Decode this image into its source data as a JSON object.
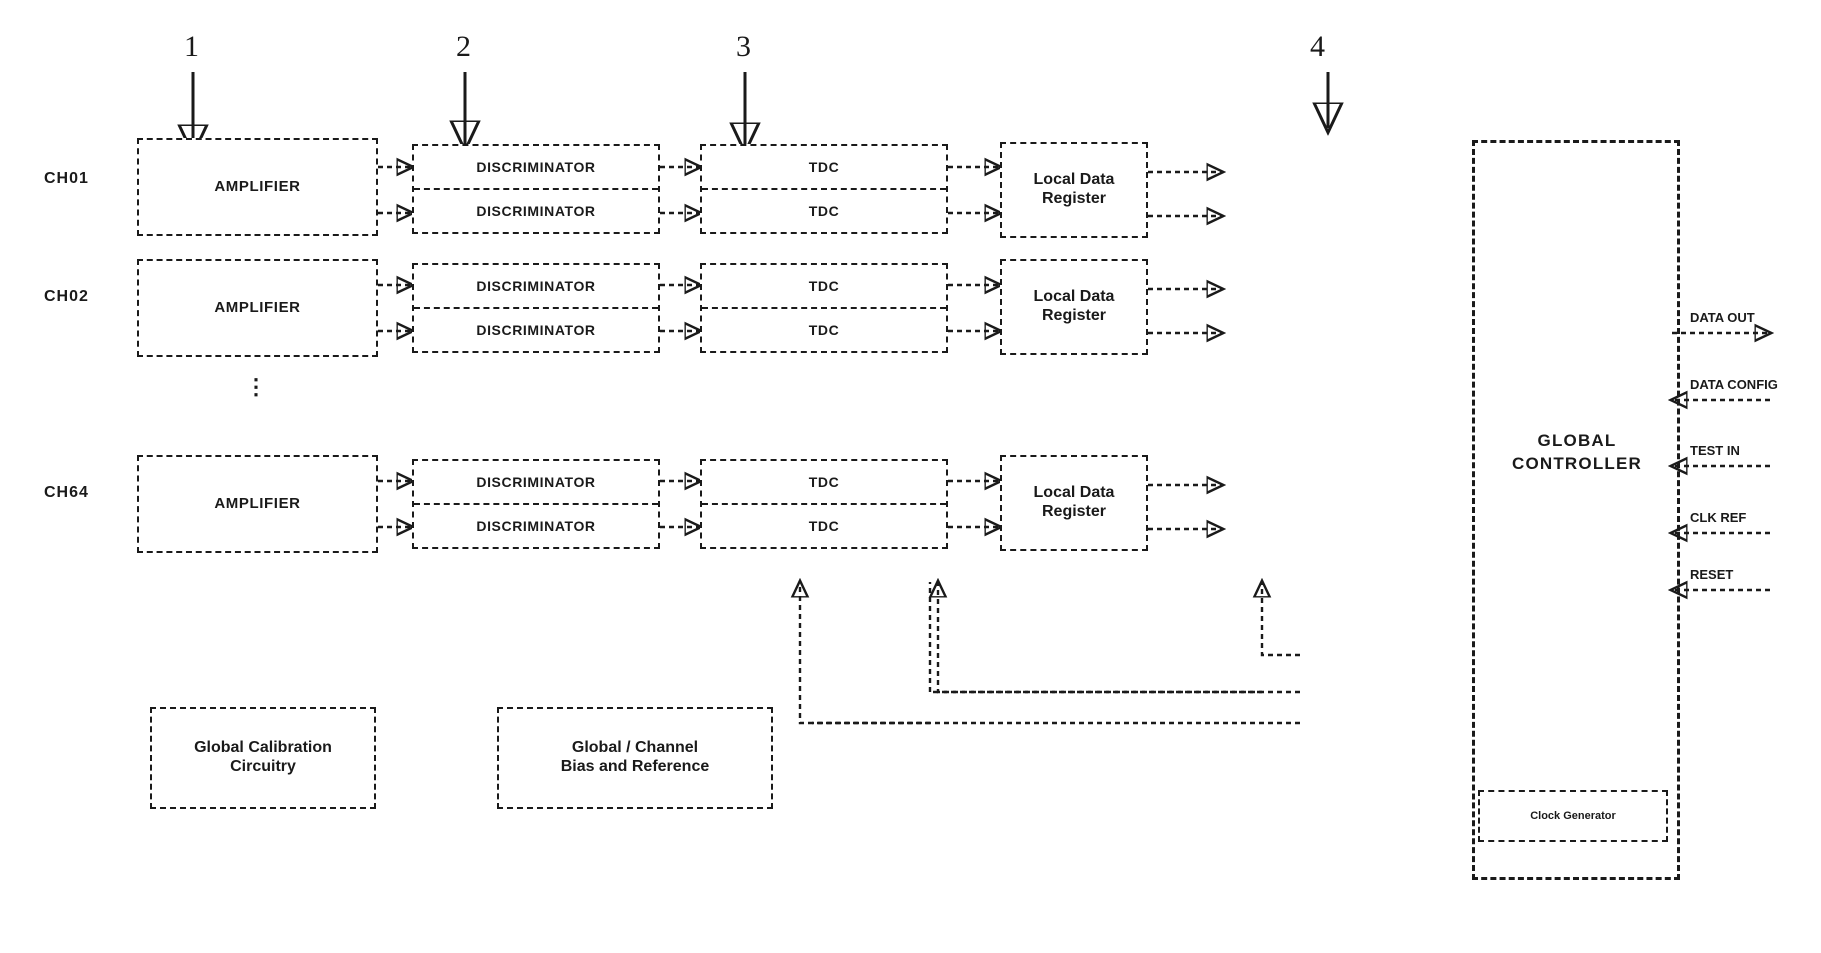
{
  "figure": {
    "title": "Front-end readout ASIC block diagram",
    "ink_color": "#1a1a1a",
    "background": "#ffffff"
  },
  "reference_numerals": [
    {
      "id": "ref-1",
      "text": "1"
    },
    {
      "id": "ref-2",
      "text": "2"
    },
    {
      "id": "ref-3",
      "text": "3"
    },
    {
      "id": "ref-4",
      "text": "4"
    }
  ],
  "channels": [
    {
      "name": "CH01",
      "amplifier": "AMPLIFIER",
      "discriminators": [
        "DISCRIMINATOR",
        "DISCRIMINATOR"
      ],
      "tdcs": [
        "TDC",
        "TDC"
      ],
      "register": "Local Data\nRegister",
      "register_line1": "Local Data",
      "register_line2": "Register"
    },
    {
      "name": "CH02",
      "amplifier": "AMPLIFIER",
      "discriminators": [
        "DISCRIMINATOR",
        "DISCRIMINATOR"
      ],
      "tdcs": [
        "TDC",
        "TDC"
      ],
      "register_line1": "Local Data",
      "register_line2": "Register"
    },
    {
      "name": "CH64",
      "amplifier": "AMPLIFIER",
      "discriminators": [
        "DISCRIMINATOR",
        "DISCRIMINATOR"
      ],
      "tdcs": [
        "TDC",
        "TDC"
      ],
      "register_line1": "Local Data",
      "register_line2": "Register"
    }
  ],
  "ellipsis": {
    "glyph": "⋮"
  },
  "support_blocks": [
    {
      "id": "global-calibration",
      "line1": "Global Calibration",
      "line2": "Circuitry"
    },
    {
      "id": "global-channel-bias",
      "line1": "Global / Channel",
      "line2": "Bias and Reference"
    }
  ],
  "global_controller": {
    "line1": "GLOBAL",
    "line2": "CONTROLLER"
  },
  "clock_generator": {
    "label": "Clock Generator"
  },
  "external_signals": [
    {
      "id": "sig-data-out",
      "label": "DATA OUT",
      "direction": "out"
    },
    {
      "id": "sig-data-config",
      "label": "DATA CONFIG",
      "direction": "in"
    },
    {
      "id": "sig-test-in",
      "label": "TEST IN",
      "direction": "in"
    },
    {
      "id": "sig-clk-ref",
      "label": "CLK REF",
      "direction": "in"
    },
    {
      "id": "sig-reset",
      "label": "RESET",
      "direction": "in"
    }
  ]
}
